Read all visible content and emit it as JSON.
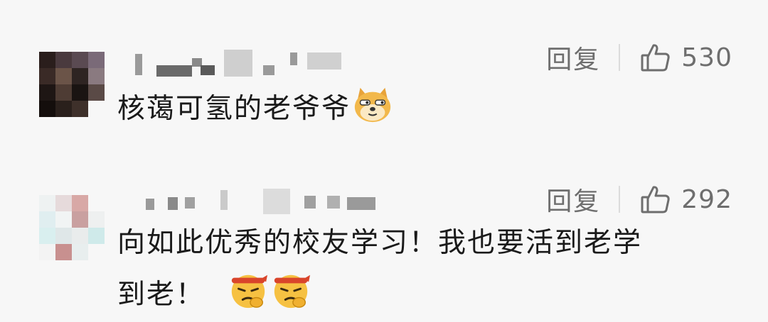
{
  "comments": [
    {
      "reply_label": "回复",
      "likes": "530",
      "text": "核蔼可氢的老爷爷",
      "emojis": [
        "doge-emoji"
      ]
    },
    {
      "reply_label": "回复",
      "likes": "292",
      "text_line1": "向如此优秀的校友学习！我也要活到老学",
      "text_line2": "到老！",
      "emojis": [
        "determined-emoji",
        "determined-emoji"
      ]
    }
  ],
  "colors": {
    "background": "#f7f7f7",
    "text": "#1a1a1a",
    "meta": "#6e6e6e"
  }
}
